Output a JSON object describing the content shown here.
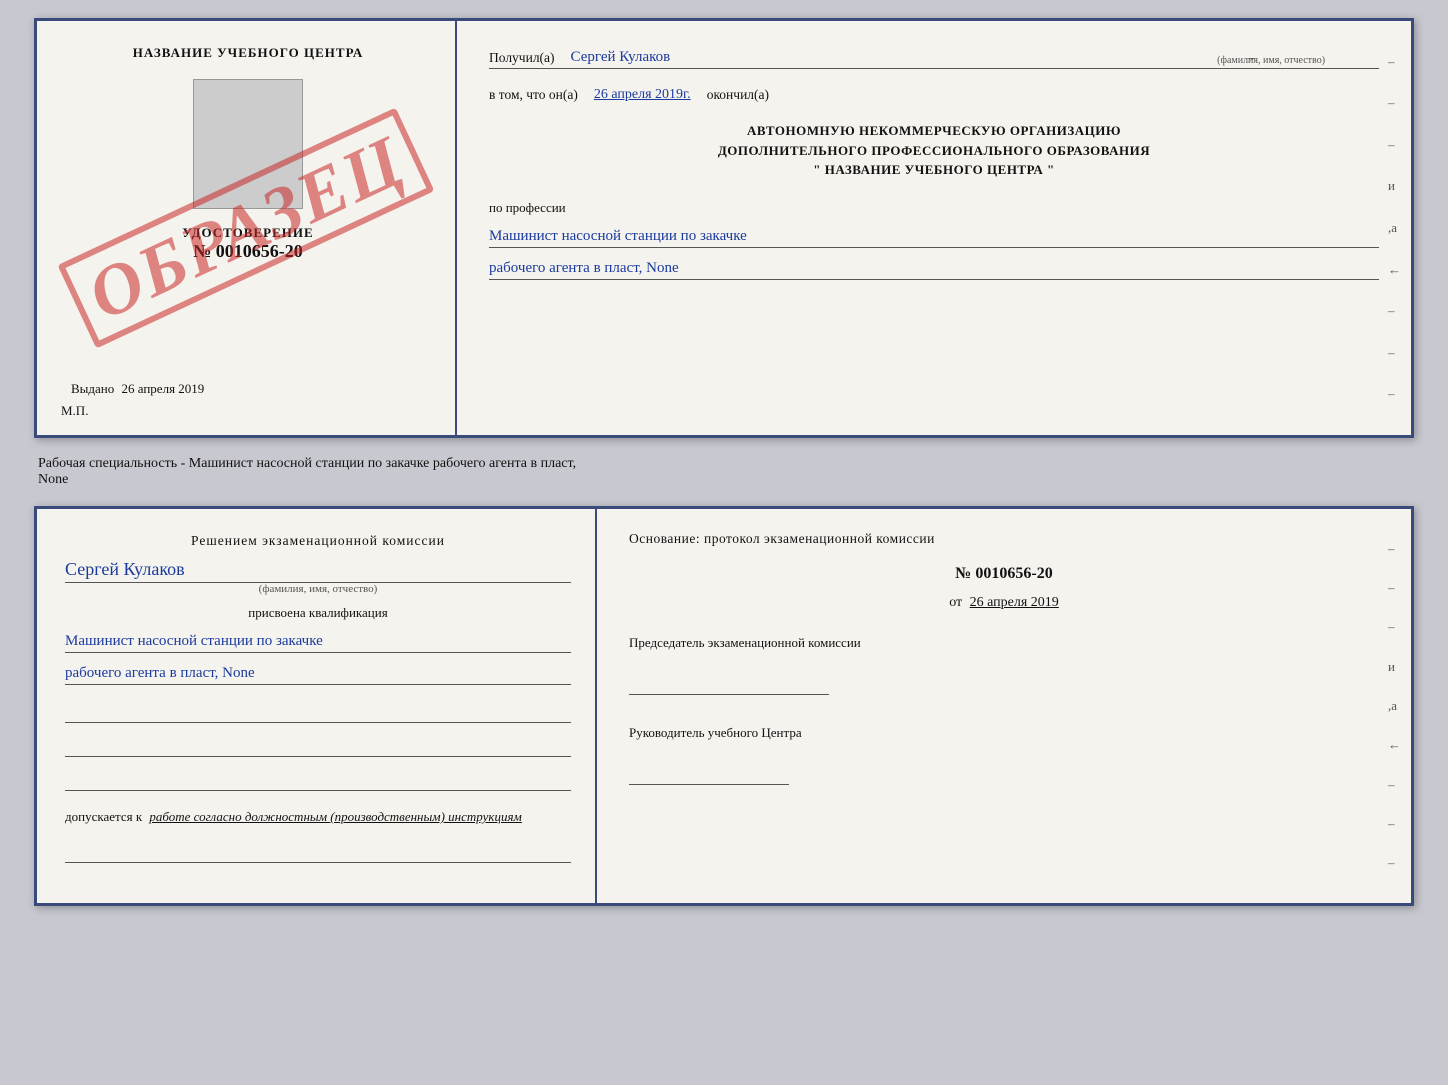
{
  "top_doc": {
    "left": {
      "title": "НАЗВАНИЕ УЧЕБНОГО ЦЕНТРА",
      "udostoverenie": "УДОСТОВЕРЕНИЕ",
      "number": "№ 0010656-20",
      "vydano_label": "Выдано",
      "vydano_date": "26 апреля 2019",
      "mp": "М.П.",
      "stamp": "ОБРАЗЕЦ"
    },
    "right": {
      "poluchil_label": "Получил(а)",
      "poluchil_name": "Сергей Кулаков",
      "fio_hint": "(фамилия, имя, отчество)",
      "vtom_label": "в том, что он(а)",
      "vtom_date": "26 апреля 2019г.",
      "okonchil_label": "окончил(а)",
      "org_line1": "АВТОНОМНУЮ НЕКОММЕРЧЕСКУЮ ОРГАНИЗАЦИЮ",
      "org_line2": "ДОПОЛНИТЕЛЬНОГО ПРОФЕССИОНАЛЬНОГО ОБРАЗОВАНИЯ",
      "org_line3": "\"  НАЗВАНИЕ УЧЕБНОГО ЦЕНТРА  \"",
      "po_professii": "по профессии",
      "profession_line1": "Машинист насосной станции по закачке",
      "profession_line2": "рабочего агента в пласт, None"
    }
  },
  "middle": {
    "text": "Рабочая специальность - Машинист насосной станции по закачке рабочего агента в пласт,",
    "text2": "None"
  },
  "bottom_doc": {
    "left": {
      "komissia_text": "Решением  экзаменационной  комиссии",
      "name": "Сергей Кулаков",
      "fio_hint": "(фамилия, имя, отчество)",
      "prisvoena": "присвоена квалификация",
      "profession_line1": "Машинист насосной станции по закачке",
      "profession_line2": "рабочего агента в пласт, None",
      "dopusk_label": "допускается к",
      "dopusk_text": "работе согласно должностным (производственным) инструкциям"
    },
    "right": {
      "osnovanie": "Основание:  протокол  экзаменационной  комиссии",
      "protocol_num": "№  0010656-20",
      "ot_label": "от",
      "ot_date": "26 апреля 2019",
      "predsedatel_title": "Председатель экзаменационной комиссии",
      "rukovoditel_title": "Руководитель учебного Центра"
    }
  }
}
